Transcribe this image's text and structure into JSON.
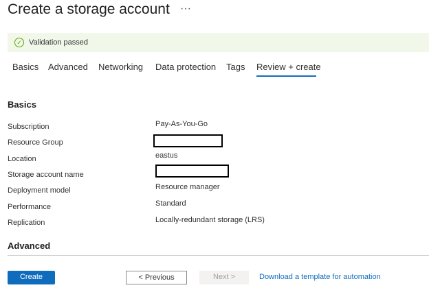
{
  "header": {
    "title": "Create a storage account",
    "more_label": "···"
  },
  "banner": {
    "text": "Validation passed",
    "icon": "check-circle-icon"
  },
  "tabs": [
    "Basics",
    "Advanced",
    "Networking",
    "Data protection",
    "Tags",
    "Review + create"
  ],
  "active_tab": "Review + create",
  "sections": {
    "basics": "Basics",
    "advanced": "Advanced"
  },
  "fields": [
    {
      "label": "Subscription",
      "value": "Pay-As-You-Go"
    },
    {
      "label": "Resource Group",
      "value": null
    },
    {
      "label": "Location",
      "value": "eastus"
    },
    {
      "label": "Storage account name",
      "value": null
    },
    {
      "label": "Deployment model",
      "value": "Resource manager"
    },
    {
      "label": "Performance",
      "value": "Standard"
    },
    {
      "label": "Replication",
      "value": "Locally-redundant storage (LRS)"
    }
  ],
  "footer": {
    "create": "Create",
    "previous": "< Previous",
    "next": "Next >",
    "download": "Download a template for automation"
  }
}
